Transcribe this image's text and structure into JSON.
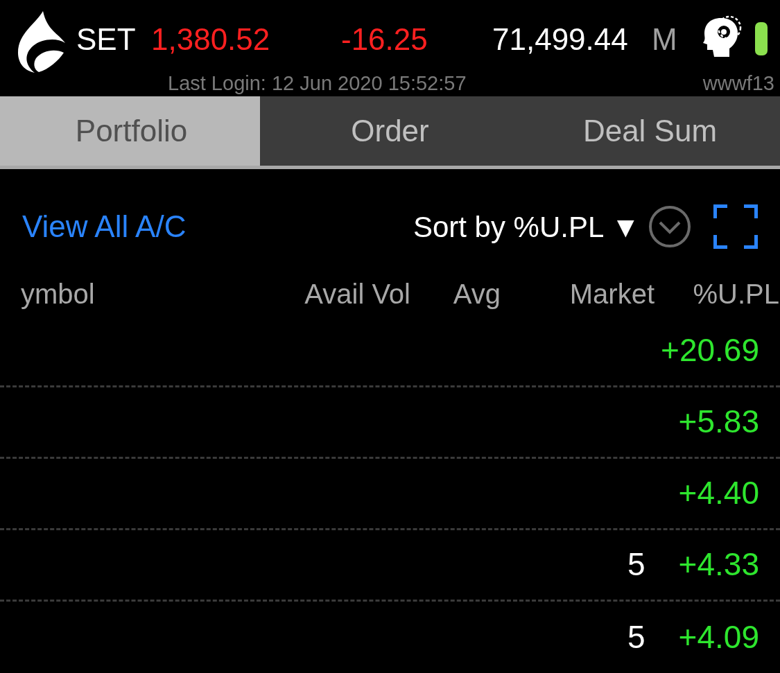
{
  "header": {
    "index_name": "SET",
    "index_value": "1,380.52",
    "change": "-16.25",
    "value": "71,499.44",
    "value_unit": "M",
    "last_login": "Last Login: 12 Jun 2020 15:52:57",
    "user": "wwwf13"
  },
  "tabs": [
    {
      "label": "Portfolio",
      "selected": true
    },
    {
      "label": "Order",
      "selected": false
    },
    {
      "label": "Deal Sum",
      "selected": false
    }
  ],
  "toolbar": {
    "view_all": "View All A/C",
    "sort": "Sort by %U.PL ▼"
  },
  "columns": [
    "ymbol",
    "Avail Vol",
    "Avg",
    "Market",
    "%U.PL"
  ],
  "rows": [
    {
      "upl": "+20.69"
    },
    {
      "upl": "+5.83"
    },
    {
      "upl": "+4.40"
    },
    {
      "market": "5",
      "upl": "+4.33"
    },
    {
      "market": "5",
      "upl": "+4.09"
    }
  ]
}
